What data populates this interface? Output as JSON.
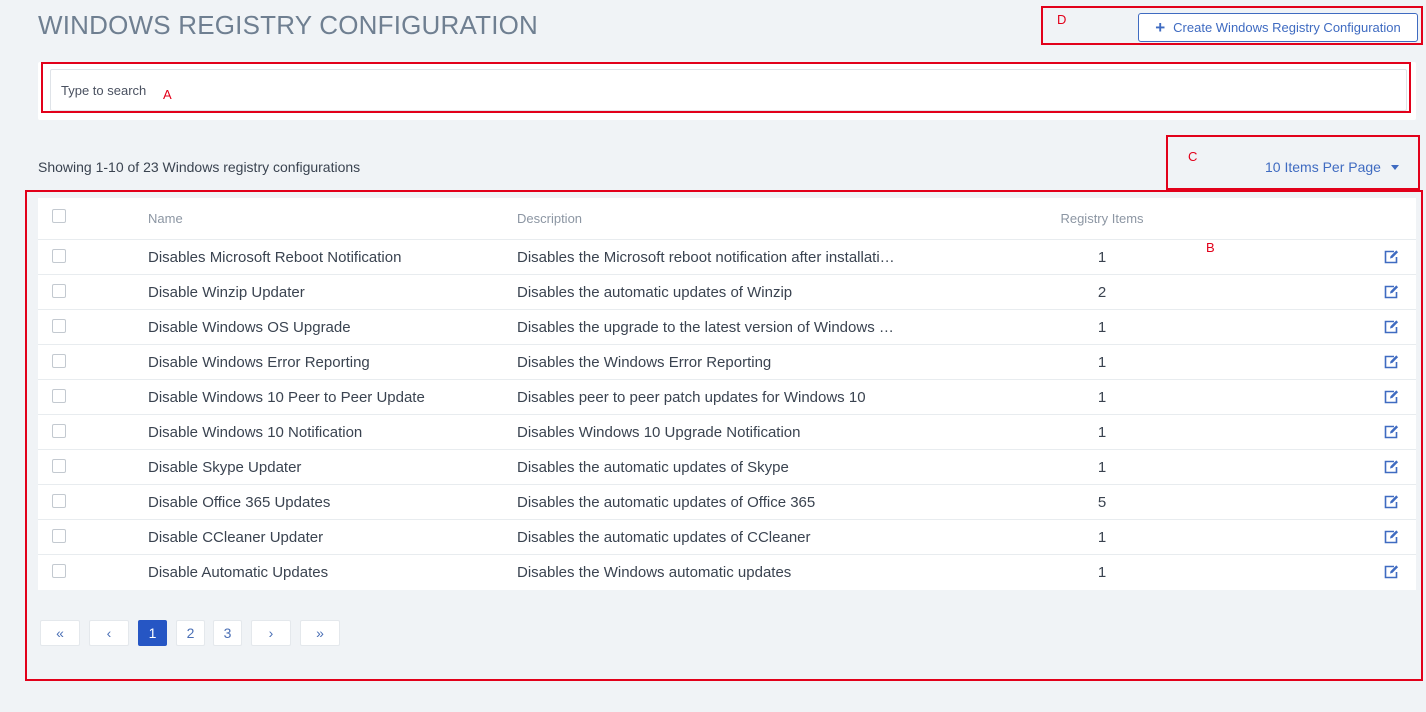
{
  "header": {
    "title": "WINDOWS REGISTRY CONFIGURATION",
    "create_button_label": "Create Windows Registry Configuration"
  },
  "search": {
    "placeholder": "Type to search"
  },
  "summary": {
    "showing_text": "Showing 1-10 of 23 Windows registry configurations",
    "items_per_page": "10 Items Per Page"
  },
  "table": {
    "columns": [
      "Name",
      "Description",
      "Registry Items"
    ],
    "rows": [
      {
        "name": "Disables Microsoft Reboot Notification",
        "description": "Disables the Microsoft reboot notification after installati…",
        "items": "1"
      },
      {
        "name": "Disable Winzip Updater",
        "description": "Disables the automatic updates of Winzip",
        "items": "2"
      },
      {
        "name": "Disable Windows OS Upgrade",
        "description": "Disables the upgrade to the latest version of Windows …",
        "items": "1"
      },
      {
        "name": "Disable Windows Error Reporting",
        "description": "Disables the Windows Error Reporting",
        "items": "1"
      },
      {
        "name": "Disable Windows 10 Peer to Peer Update",
        "description": "Disables peer to peer patch updates for Windows 10",
        "items": "1"
      },
      {
        "name": "Disable Windows 10 Notification",
        "description": "Disables Windows 10 Upgrade Notification",
        "items": "1"
      },
      {
        "name": "Disable Skype Updater",
        "description": "Disables the automatic updates of Skype",
        "items": "1"
      },
      {
        "name": "Disable Office 365 Updates",
        "description": "Disables the automatic updates of Office 365",
        "items": "5"
      },
      {
        "name": "Disable CCleaner Updater",
        "description": "Disables the automatic updates of CCleaner",
        "items": "1"
      },
      {
        "name": "Disable Automatic Updates",
        "description": "Disables the Windows automatic updates",
        "items": "1"
      }
    ]
  },
  "pagination": {
    "first": "«",
    "prev": "‹",
    "pages": [
      "1",
      "2",
      "3"
    ],
    "current": "1",
    "next": "›",
    "last": "»"
  },
  "annotations": {
    "a": "A",
    "b": "B",
    "c": "C",
    "d": "D"
  },
  "colors": {
    "accent": "#3f6bc1",
    "annotation": "#e2001a",
    "background": "#f0f3f6"
  }
}
